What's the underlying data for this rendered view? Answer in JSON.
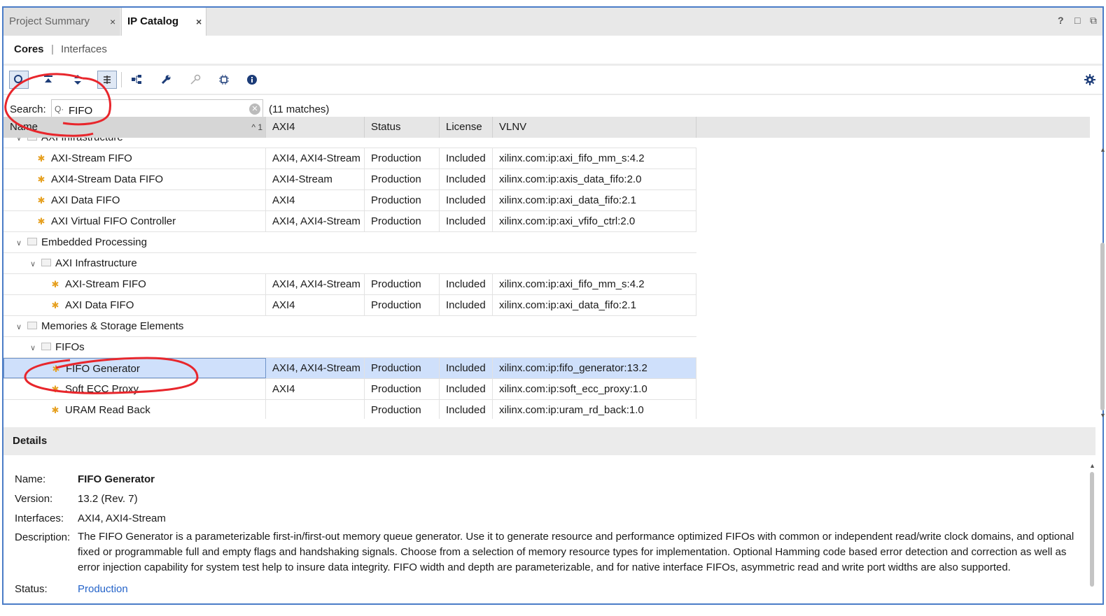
{
  "tabs": {
    "project_summary": "Project Summary",
    "ip_catalog": "IP Catalog",
    "close": "×"
  },
  "window_controls": {
    "help": "?",
    "restore": "□",
    "float": "⧉"
  },
  "subtabs": {
    "cores": "Cores",
    "separator": "|",
    "interfaces": "Interfaces"
  },
  "search": {
    "label": "Search:",
    "value": "FIFO",
    "matches": "(11 matches)"
  },
  "columns": {
    "name": "Name",
    "sort": "^ 1",
    "axi4": "AXI4",
    "status": "Status",
    "license": "License",
    "vlnv": "VLNV"
  },
  "rows": [
    {
      "type": "folder",
      "level": 1,
      "name": "AXI Infrastructure"
    },
    {
      "type": "ip",
      "level": 2,
      "name": "AXI-Stream FIFO",
      "axi4": "AXI4, AXI4-Stream",
      "status": "Production",
      "license": "Included",
      "vlnv": "xilinx.com:ip:axi_fifo_mm_s:4.2"
    },
    {
      "type": "ip",
      "level": 2,
      "name": "AXI4-Stream Data FIFO",
      "axi4": "AXI4-Stream",
      "status": "Production",
      "license": "Included",
      "vlnv": "xilinx.com:ip:axis_data_fifo:2.0"
    },
    {
      "type": "ip",
      "level": 2,
      "name": "AXI Data FIFO",
      "axi4": "AXI4",
      "status": "Production",
      "license": "Included",
      "vlnv": "xilinx.com:ip:axi_data_fifo:2.1"
    },
    {
      "type": "ip",
      "level": 2,
      "name": "AXI Virtual FIFO Controller",
      "axi4": "AXI4, AXI4-Stream",
      "status": "Production",
      "license": "Included",
      "vlnv": "xilinx.com:ip:axi_vfifo_ctrl:2.0"
    },
    {
      "type": "folder",
      "level": 1,
      "name": "Embedded Processing"
    },
    {
      "type": "folder",
      "level": 2,
      "name": "AXI Infrastructure"
    },
    {
      "type": "ip",
      "level": 3,
      "name": "AXI-Stream FIFO",
      "axi4": "AXI4, AXI4-Stream",
      "status": "Production",
      "license": "Included",
      "vlnv": "xilinx.com:ip:axi_fifo_mm_s:4.2"
    },
    {
      "type": "ip",
      "level": 3,
      "name": "AXI Data FIFO",
      "axi4": "AXI4",
      "status": "Production",
      "license": "Included",
      "vlnv": "xilinx.com:ip:axi_data_fifo:2.1"
    },
    {
      "type": "folder",
      "level": 1,
      "name": "Memories & Storage Elements"
    },
    {
      "type": "folder",
      "level": 2,
      "name": "FIFOs"
    },
    {
      "type": "ip",
      "level": 3,
      "name": "FIFO Generator",
      "axi4": "AXI4, AXI4-Stream",
      "status": "Production",
      "license": "Included",
      "vlnv": "xilinx.com:ip:fifo_generator:13.2",
      "selected": true
    },
    {
      "type": "ip",
      "level": 3,
      "name": "Soft ECC Proxy",
      "axi4": "AXI4",
      "status": "Production",
      "license": "Included",
      "vlnv": "xilinx.com:ip:soft_ecc_proxy:1.0"
    },
    {
      "type": "ip",
      "level": 3,
      "name": "URAM Read Back",
      "axi4": "",
      "status": "Production",
      "license": "Included",
      "vlnv": "xilinx.com:ip:uram_rd_back:1.0"
    }
  ],
  "details": {
    "header": "Details",
    "name_label": "Name:",
    "name": "FIFO Generator",
    "version_label": "Version:",
    "version": "13.2 (Rev. 7)",
    "interfaces_label": "Interfaces:",
    "interfaces": "AXI4, AXI4-Stream",
    "description_label": "Description:",
    "description": "The FIFO Generator is a parameterizable first-in/first-out memory queue generator. Use it to generate resource and performance optimized FIFOs with common or independent read/write clock domains, and optional fixed or programmable full and empty flags and handshaking signals.  Choose from a selection of memory resource types for implementation.  Optional Hamming code based error detection and correction as well as error injection capability for system test help to insure data integrity.  FIFO width and depth are parameterizable, and for native interface FIFOs, asymmetric read and write port widths are also supported.",
    "status_label": "Status:",
    "status": "Production"
  },
  "colors": {
    "frame": "#4a7cc7",
    "selected_row": "#cfe0fb",
    "link": "#2463c9",
    "annotation": "#e8262c",
    "ip_icon": "#e6a020"
  }
}
